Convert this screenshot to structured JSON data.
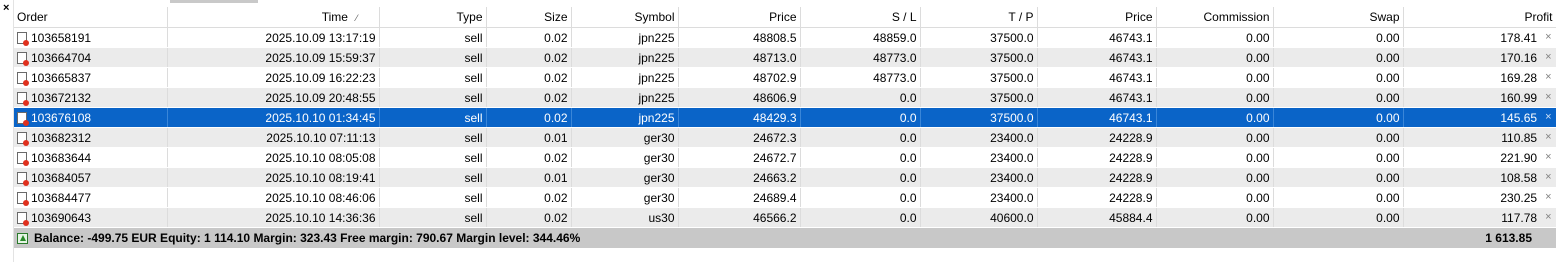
{
  "window": {
    "close_glyph": "×"
  },
  "columns": {
    "order": "Order",
    "time": "Time",
    "time_sort_glyph": "⁄",
    "type": "Type",
    "size": "Size",
    "symbol": "Symbol",
    "price_open": "Price",
    "sl": "S / L",
    "tp": "T / P",
    "price_current": "Price",
    "commission": "Commission",
    "swap": "Swap",
    "profit": "Profit"
  },
  "rows": [
    {
      "order": "103658191",
      "time": "2025.10.09 13:17:19",
      "type": "sell",
      "size": "0.02",
      "symbol": "jpn225",
      "price_open": "48808.5",
      "sl": "48859.0",
      "tp": "37500.0",
      "price_current": "46743.1",
      "commission": "0.00",
      "swap": "0.00",
      "profit": "178.41"
    },
    {
      "order": "103664704",
      "time": "2025.10.09 15:59:37",
      "type": "sell",
      "size": "0.02",
      "symbol": "jpn225",
      "price_open": "48713.0",
      "sl": "48773.0",
      "tp": "37500.0",
      "price_current": "46743.1",
      "commission": "0.00",
      "swap": "0.00",
      "profit": "170.16"
    },
    {
      "order": "103665837",
      "time": "2025.10.09 16:22:23",
      "type": "sell",
      "size": "0.02",
      "symbol": "jpn225",
      "price_open": "48702.9",
      "sl": "48773.0",
      "tp": "37500.0",
      "price_current": "46743.1",
      "commission": "0.00",
      "swap": "0.00",
      "profit": "169.28"
    },
    {
      "order": "103672132",
      "time": "2025.10.09 20:48:55",
      "type": "sell",
      "size": "0.02",
      "symbol": "jpn225",
      "price_open": "48606.9",
      "sl": "0.0",
      "tp": "37500.0",
      "price_current": "46743.1",
      "commission": "0.00",
      "swap": "0.00",
      "profit": "160.99"
    },
    {
      "order": "103676108",
      "time": "2025.10.10 01:34:45",
      "type": "sell",
      "size": "0.02",
      "symbol": "jpn225",
      "price_open": "48429.3",
      "sl": "0.0",
      "tp": "37500.0",
      "price_current": "46743.1",
      "commission": "0.00",
      "swap": "0.00",
      "profit": "145.65"
    },
    {
      "order": "103682312",
      "time": "2025.10.10 07:11:13",
      "type": "sell",
      "size": "0.01",
      "symbol": "ger30",
      "price_open": "24672.3",
      "sl": "0.0",
      "tp": "23400.0",
      "price_current": "24228.9",
      "commission": "0.00",
      "swap": "0.00",
      "profit": "110.85"
    },
    {
      "order": "103683644",
      "time": "2025.10.10 08:05:08",
      "type": "sell",
      "size": "0.02",
      "symbol": "ger30",
      "price_open": "24672.7",
      "sl": "0.0",
      "tp": "23400.0",
      "price_current": "24228.9",
      "commission": "0.00",
      "swap": "0.00",
      "profit": "221.90"
    },
    {
      "order": "103684057",
      "time": "2025.10.10 08:19:41",
      "type": "sell",
      "size": "0.01",
      "symbol": "ger30",
      "price_open": "24663.2",
      "sl": "0.0",
      "tp": "23400.0",
      "price_current": "24228.9",
      "commission": "0.00",
      "swap": "0.00",
      "profit": "108.58"
    },
    {
      "order": "103684477",
      "time": "2025.10.10 08:46:06",
      "type": "sell",
      "size": "0.02",
      "symbol": "ger30",
      "price_open": "24689.4",
      "sl": "0.0",
      "tp": "23400.0",
      "price_current": "24228.9",
      "commission": "0.00",
      "swap": "0.00",
      "profit": "230.25"
    },
    {
      "order": "103690643",
      "time": "2025.10.10 14:36:36",
      "type": "sell",
      "size": "0.02",
      "symbol": "us30",
      "price_open": "46566.2",
      "sl": "0.0",
      "tp": "40600.0",
      "price_current": "45884.4",
      "commission": "0.00",
      "swap": "0.00",
      "profit": "117.78"
    }
  ],
  "selected_row_index": 4,
  "row_close_glyph": "×",
  "summary": {
    "text": "Balance: -499.75 EUR  Equity: 1 114.10  Margin: 323.43  Free margin: 790.67  Margin level: 344.46%",
    "total_profit": "1 613.85"
  },
  "colors": {
    "selection": "#0a64c8",
    "alt_row": "#ebebeb",
    "summary_bg": "#c8c8c8",
    "loss_marker": "#e0301e"
  },
  "icons": {
    "order_row": "order-document-icon",
    "summary": "balance-up-icon",
    "row_close": "close-position-icon"
  }
}
